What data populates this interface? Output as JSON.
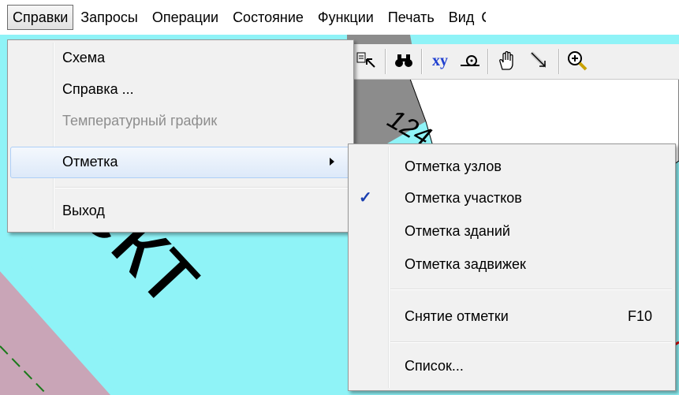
{
  "menubar": {
    "items": [
      {
        "label": "Справки",
        "active": true
      },
      {
        "label": "Запросы"
      },
      {
        "label": "Операции"
      },
      {
        "label": "Состояние"
      },
      {
        "label": "Функции"
      },
      {
        "label": "Печать"
      },
      {
        "label": "Вид"
      },
      {
        "label": "С"
      }
    ]
  },
  "map": {
    "label_big": "ект",
    "label_small": "124",
    "colors": {
      "water": "#8ff3f7",
      "building": "#c9a5b7",
      "grey": "#8c8c8c",
      "white": "#ffffff"
    }
  },
  "toolbar": {
    "icons": [
      "select-pointer-icon",
      "binoculars-icon",
      "xy-coordinates-icon",
      "measure-icon",
      "hand-pan-icon",
      "arrow-pointer-icon",
      "zoom-in-icon"
    ],
    "xy_label": "xy"
  },
  "menu_spravki": {
    "items": [
      {
        "label": "Схема"
      },
      {
        "label": "Справка ..."
      },
      {
        "label": "Температурный график",
        "disabled": true
      },
      {
        "label": "Отметка",
        "submenu": true,
        "highlighted": true
      },
      {
        "label": "Выход"
      }
    ]
  },
  "submenu_otmetka": {
    "items": [
      {
        "label": "Отметка узлов"
      },
      {
        "label": "Отметка участков",
        "checked": true
      },
      {
        "label": "Отметка зданий"
      },
      {
        "label": "Отметка задвижек"
      },
      {
        "label": "Снятие отметки",
        "shortcut": "F10"
      },
      {
        "label": "Список..."
      }
    ],
    "check_mark": "✓"
  }
}
